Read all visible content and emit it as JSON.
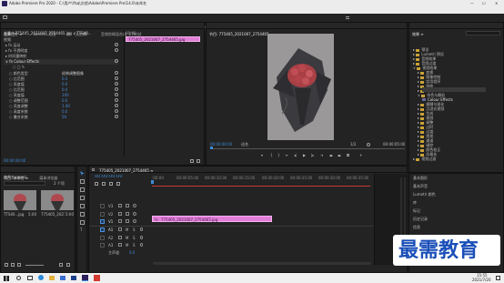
{
  "window": {
    "title": "Adobe Premiere Pro 2020 - C:\\用户\\Ybq\\文档\\Adobe\\Premiere Pro\\14.0\\未命名",
    "controls": [
      "—",
      "☐",
      "✕"
    ]
  },
  "menu": [
    "文件(F)",
    "编辑(E)",
    "剪辑(C)",
    "序列(S)",
    "标记(M)",
    "图形(G)",
    "视图(V)",
    "窗口(W)",
    "帮助(H)"
  ],
  "workspaces": {
    "items": [
      "学习",
      "组件",
      "编辑",
      "颜色",
      "效果",
      "音频",
      "图形",
      "库"
    ],
    "active": 4
  },
  "effect_controls": {
    "tabs": [
      "效果控件 ≡",
      "Lumetri 范围",
      "源:（无剪辑）",
      "音频剪辑混合器: 27ddj4"
    ],
    "header_path": "主要 * 775405_2021007_2754465.jpg ∨   TTS40...",
    "header_clip": "775405_2021007_2754465.jpg",
    "header_time": "00:00",
    "rows": [
      {
        "label": "视频",
        "value": ""
      },
      {
        "label": "▸ fx 运动",
        "value": ""
      },
      {
        "label": "▸ fx 不透明度",
        "value": ""
      },
      {
        "label": "▸ 时间重映射",
        "value": ""
      },
      {
        "label": "∨ fx Colour Effects",
        "value": ""
      },
      {
        "label": "○ □ ✎",
        "value": ""
      },
      {
        "label": "○ 颜色类型",
        "value": "经典调整图像"
      },
      {
        "label": "○ 比范围",
        "value": "0.0"
      },
      {
        "label": "○ 亮度值",
        "value": "0.0"
      },
      {
        "label": "○ 比范围",
        "value": "0.0"
      },
      {
        "label": "○ 亮度值",
        "value": "100"
      },
      {
        "label": "○ 调整范围",
        "value": "0.0"
      },
      {
        "label": "○ 亮度调整",
        "value": "1.00"
      },
      {
        "label": "○ 高度系数",
        "value": "0.0"
      },
      {
        "label": "○ 叠合系数",
        "value": "50"
      }
    ],
    "timecode": "00:00:00:00"
  },
  "program": {
    "title": "节目: 775405_2021007_2754465 ≡",
    "timecode_left": "00:00:00:00",
    "fit": "适合",
    "fraction": "1/2",
    "timecode_right": "00:00:05:00"
  },
  "project": {
    "tabs": [
      "项目: 未命名 ≡",
      "媒体浏览器"
    ],
    "filename": "未命名.prproj",
    "search_placeholder": "",
    "item_count": "2 个项",
    "items": [
      {
        "name": "TTS40...jpg",
        "duration": "5:00"
      },
      {
        "name": "775405_2021007...",
        "duration": "5:00"
      }
    ]
  },
  "timeline": {
    "tab": "775405_2021007_2754465 ≡",
    "timecode": "00:00:00:00",
    "ruler": [
      ":00:00",
      "00:00:05:00",
      "00:00:10:00",
      "00:00:15:00",
      "00:00:20:00",
      "00:00:25:00",
      "00:00:30:00",
      "00:00:35:00"
    ],
    "tracks": [
      "V3",
      "V2",
      "V1",
      "A1",
      "A2",
      "A3",
      "主声道"
    ],
    "track_buttons": [
      "6",
      "M",
      "S"
    ],
    "master_value": "0.0",
    "clip": "775405_2021007_2754465.jpg"
  },
  "effects": {
    "title": "效果 ≡",
    "tree": [
      {
        "label": "预设",
        "depth": 0,
        "selected": false
      },
      {
        "label": "Lumetri 预设",
        "depth": 0,
        "selected": false
      },
      {
        "label": "音频效果",
        "depth": 0,
        "selected": false
      },
      {
        "label": "音频过渡",
        "depth": 0,
        "selected": false
      },
      {
        "label": "视频效果",
        "depth": 0,
        "selected": false
      },
      {
        "label": "变换",
        "depth": 1,
        "selected": false
      },
      {
        "label": "图像控制",
        "depth": 1,
        "selected": false
      },
      {
        "label": "实用程序",
        "depth": 1,
        "selected": false
      },
      {
        "label": "扭曲",
        "depth": 1,
        "selected": false
      },
      {
        "label": "时间",
        "depth": 1,
        "selected": false
      },
      {
        "label": "杂色与颗粒",
        "depth": 1,
        "selected": false
      },
      {
        "label": "Colour Effects",
        "depth": 2,
        "selected": true
      },
      {
        "label": "模糊与锐化",
        "depth": 1,
        "selected": false
      },
      {
        "label": "沉浸式视频",
        "depth": 1,
        "selected": false
      },
      {
        "label": "生成",
        "depth": 1,
        "selected": false
      },
      {
        "label": "视频",
        "depth": 1,
        "selected": false
      },
      {
        "label": "调整",
        "depth": 1,
        "selected": false
      },
      {
        "label": "过时",
        "depth": 1,
        "selected": false
      },
      {
        "label": "过渡",
        "depth": 1,
        "selected": false
      },
      {
        "label": "透视",
        "depth": 1,
        "selected": false
      },
      {
        "label": "通道",
        "depth": 1,
        "selected": false
      },
      {
        "label": "键控",
        "depth": 1,
        "selected": false
      },
      {
        "label": "颜色校正",
        "depth": 1,
        "selected": false
      },
      {
        "label": "风格化",
        "depth": 1,
        "selected": false
      },
      {
        "label": "视频过渡",
        "depth": 0,
        "selected": false
      }
    ],
    "panels": [
      "基本图形",
      "基本声音",
      "Lumetri 颜色",
      "库",
      "标记",
      "历史记录",
      "信息"
    ]
  },
  "watermark": "最需教育",
  "taskbar": {
    "time": "15:55",
    "date": "2021/7/20"
  }
}
